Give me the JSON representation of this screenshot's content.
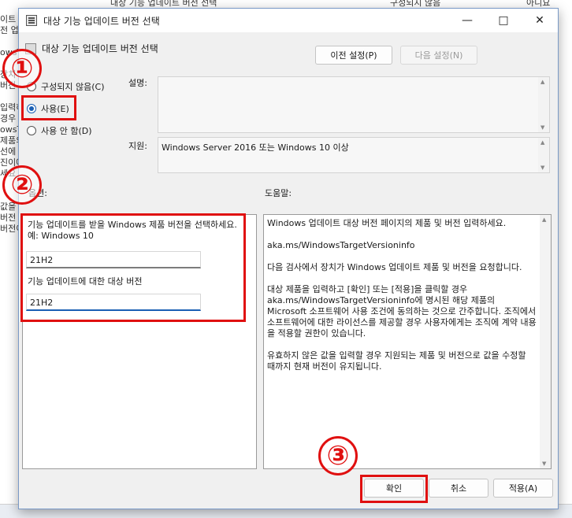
{
  "background": {
    "top_left_text": "대상 기능 업데이트 버전 선택",
    "top_mid_text": "구성되지 않음",
    "top_right_text": "아니요",
    "left_fragments": [
      "이트",
      "전 업",
      "",
      "owsT",
      "",
      "장치",
      "버전",
      "",
      "입력하",
      "경우",
      "owsT",
      "제품의",
      "선에",
      "진이에",
      "세요",
      "",
      "",
      "값을",
      "버전",
      "버전이"
    ]
  },
  "dialog": {
    "title": "대상 기능 업데이트 버전 선택",
    "header": "대상 기능 업데이트 버전 선택",
    "prev_button": "이전 설정(P)",
    "next_button": "다음 설정(N)",
    "radios": [
      {
        "label": "구성되지 않음(C)",
        "checked": false
      },
      {
        "label": "사용(E)",
        "checked": true
      },
      {
        "label": "사용 안 함(D)",
        "checked": false
      }
    ],
    "description_label": "설명:",
    "description_text": "",
    "supported_label": "지원:",
    "supported_text": "Windows Server 2016 또는 Windows 10 이상",
    "options_label": "옵션:",
    "help_label": "도움말:",
    "options": {
      "field1_label": "기능 업데이트를 받을 Windows 제품 버전을 선택하세요. 예: Windows 10",
      "field1_value": "21H2",
      "field2_label": "기능 업데이트에 대한 대상 버전",
      "field2_value": "21H2"
    },
    "help_paragraphs": [
      "Windows 업데이트 대상 버전 페이지의 제품 및 버전 입력하세요.",
      "aka.ms/WindowsTargetVersioninfo",
      "다음 검사에서 장치가 Windows 업데이트 제품 및 버전을 요청합니다.",
      "대상 제품을 입력하고 [확인] 또는 [적용]을 클릭할 경우 aka.ms/WindowsTargetVersioninfo에 명시된 해당 제품의 Microsoft 소프트웨어 사용 조건에 동의하는 것으로 간주합니다. 조직에서 소프트웨어에 대한 라이선스를 제공할 경우 사용자에게는 조직에 계약 내용을 적용할 권한이 있습니다.",
      "유효하지 않은 값을 입력할 경우 지원되는 제품 및 버전으로 값을 수정할 때까지 현재 버전이 유지됩니다."
    ],
    "ok_button": "확인",
    "cancel_button": "취소",
    "apply_button": "적용(A)"
  },
  "annotations": {
    "n1": "①",
    "n2": "②",
    "n3": "③"
  },
  "colors": {
    "annotation": "#e01010",
    "accent": "#1a5fb4"
  }
}
